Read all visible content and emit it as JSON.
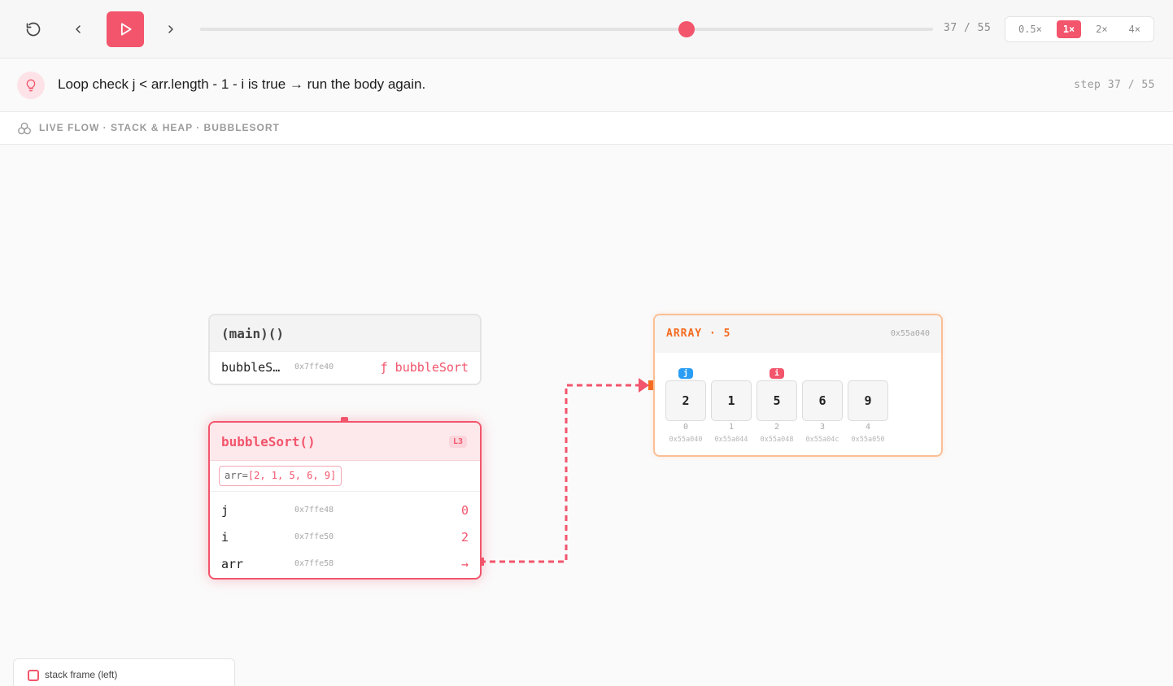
{
  "toolbar": {
    "counter": "37 / 55",
    "progress_fraction": 0.6667,
    "speeds": [
      {
        "label": "0.5×",
        "active": false
      },
      {
        "label": "1×",
        "active": true
      },
      {
        "label": "2×",
        "active": false
      },
      {
        "label": "4×",
        "active": false
      }
    ]
  },
  "explanation": {
    "text": "Loop check j < arr.length - 1 - i is true → run the body again.",
    "step": "step 37 / 55"
  },
  "section": {
    "label": "LIVE FLOW · STACK & HEAP · BUBBLESORT"
  },
  "main_frame": {
    "title": "(main)()",
    "vars": [
      {
        "name": "bubbleS…",
        "addr": "0x7ffe40",
        "value": "ƒ bubbleSort"
      }
    ]
  },
  "bubble_frame": {
    "title": "bubbleSort()",
    "line": "L3",
    "args_key": "arr=",
    "args_value": "[2, 1, 5, 6, 9]",
    "vars": [
      {
        "name": "j",
        "addr": "0x7ffe48",
        "value": "0"
      },
      {
        "name": "i",
        "addr": "0x7ffe50",
        "value": "2"
      },
      {
        "name": "arr",
        "addr": "0x7ffe58",
        "value": "→"
      }
    ]
  },
  "array": {
    "title": "ARRAY · 5",
    "addr": "0x55a040",
    "cells": [
      {
        "value": "2",
        "index": "0",
        "addr": "0x55a040",
        "pointer": "j"
      },
      {
        "value": "1",
        "index": "1",
        "addr": "0x55a044",
        "pointer": ""
      },
      {
        "value": "5",
        "index": "2",
        "addr": "0x55a048",
        "pointer": "i"
      },
      {
        "value": "6",
        "index": "3",
        "addr": "0x55a04c",
        "pointer": ""
      },
      {
        "value": "9",
        "index": "4",
        "addr": "0x55a050",
        "pointer": ""
      }
    ]
  },
  "legend": {
    "label": "stack frame (left)"
  },
  "colors": {
    "accent": "#f2556c",
    "array_accent": "#f46b1f",
    "pointer_j": "#2a9df4",
    "pointer_i": "#f2556c"
  }
}
